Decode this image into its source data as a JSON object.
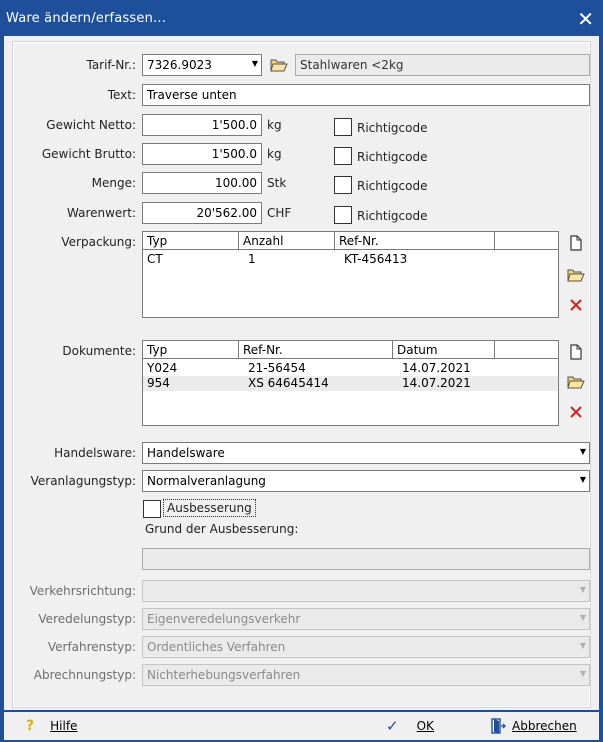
{
  "window": {
    "title": "Ware ändern/erfassen...",
    "close_glyph": "✕"
  },
  "tarif": {
    "label": "Tarif-Nr.:",
    "value": "7326.9023",
    "description": "Stahlwaren <2kg"
  },
  "text": {
    "label": "Text:",
    "value": "Traverse unten"
  },
  "gewicht_netto": {
    "label": "Gewicht Netto:",
    "value": "1'500.0",
    "unit": "kg",
    "check_label": "Richtigcode"
  },
  "gewicht_brutto": {
    "label": "Gewicht Brutto:",
    "value": "1'500.0",
    "unit": "kg",
    "check_label": "Richtigcode"
  },
  "menge": {
    "label": "Menge:",
    "value": "100.00",
    "unit": "Stk",
    "check_label": "Richtigcode"
  },
  "warenwert": {
    "label": "Warenwert:",
    "value": "20'562.00",
    "unit": "CHF",
    "check_label": "Richtigcode"
  },
  "verpackung": {
    "label": "Verpackung:",
    "columns": [
      "Typ",
      "Anzahl",
      "Ref-Nr."
    ],
    "rows": [
      [
        "CT",
        "1",
        "KT-456413"
      ]
    ]
  },
  "dokumente": {
    "label": "Dokumente:",
    "columns": [
      "Typ",
      "Ref-Nr.",
      "Datum"
    ],
    "rows": [
      [
        "Y024",
        "21-56454",
        "14.07.2021"
      ],
      [
        "954",
        "XS 64645414",
        "14.07.2021"
      ]
    ]
  },
  "handelsware": {
    "label": "Handelsware:",
    "value": "Handelsware"
  },
  "veranlagungstyp": {
    "label": "Veranlagungstyp:",
    "value": "Normalveranlagung"
  },
  "ausbesserung": {
    "label": "Ausbesserung",
    "grund_label": "Grund der Ausbesserung:",
    "grund_value": ""
  },
  "verkehrsrichtung": {
    "label": "Verkehrsrichtung:",
    "value": ""
  },
  "veredelungstyp": {
    "label": "Veredelungstyp:",
    "value": "Eigenveredelungsverkehr"
  },
  "verfahrenstyp": {
    "label": "Verfahrenstyp:",
    "value": "Ordentliches Verfahren"
  },
  "abrechnungstyp": {
    "label": "Abrechnungstyp:",
    "value": "Nichterhebungsverfahren"
  },
  "buttons": {
    "help_icon": "?",
    "help_label": "Hilfe",
    "ok_icon": "✓",
    "ok_label": "OK",
    "cancel_label": "Abbrechen"
  },
  "colors": {
    "titlebar": "#1e4f9a",
    "delete_red": "#d42020",
    "folder_yellow": "#e8b830"
  },
  "icons": [
    "folder-open-icon",
    "new-document-icon",
    "delete-icon",
    "checkmark-icon",
    "exit-door-icon",
    "help-icon",
    "close-icon",
    "chevron-down-icon"
  ]
}
